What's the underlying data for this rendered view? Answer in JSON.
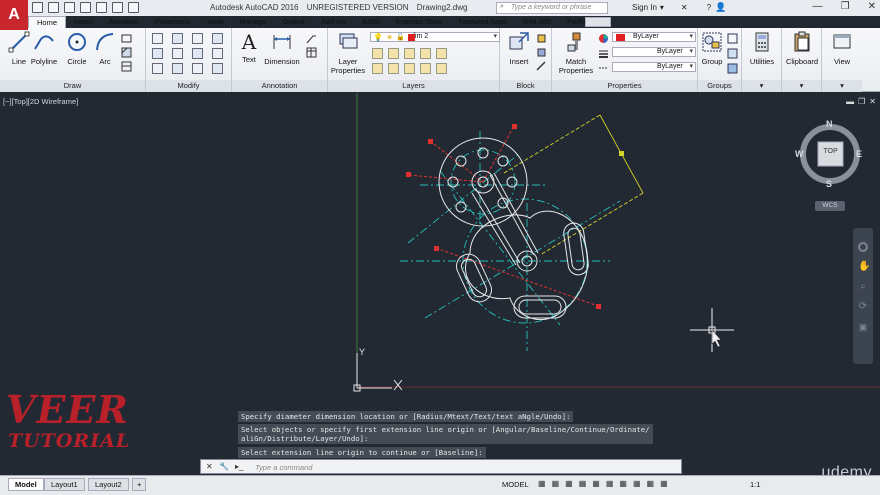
{
  "app": {
    "title": "Autodesk AutoCAD 2016",
    "version_note": "UNREGISTERED VERSION",
    "file": "Drawing2.dwg",
    "search_placeholder": "Type a keyword or phrase",
    "signin": "Sign In"
  },
  "tabs": [
    "Home",
    "Insert",
    "Annotate",
    "Parametric",
    "View",
    "Manage",
    "Output",
    "Add-ins",
    "A360",
    "Express Tools",
    "Featured Apps",
    "BIM 360",
    "Performance"
  ],
  "ribbon": {
    "draw": {
      "title": "Draw",
      "line": "Line",
      "polyline": "Polyline",
      "circle": "Circle",
      "arc": "Arc"
    },
    "modify": {
      "title": "Modify"
    },
    "annotation": {
      "title": "Annotation",
      "text": "Text",
      "dimension": "Dimension"
    },
    "layers": {
      "title": "Layers",
      "layer_props": "Layer",
      "layer_props2": "Properties",
      "current_layer": "dim 2"
    },
    "block": {
      "title": "Block",
      "insert": "Insert"
    },
    "properties": {
      "title": "Properties",
      "match": "Match",
      "match2": "Properties",
      "color": "ByLayer",
      "linetype": "ByLayer",
      "lineweight": "ByLayer"
    },
    "groups": {
      "title": "Groups",
      "group": "Group"
    },
    "utilities": "Utilities",
    "clipboard": "Clipboard",
    "view": "View"
  },
  "viewport": {
    "label": "[−][Top][2D Wireframe]",
    "viewcube_top": "TOP",
    "compass": {
      "n": "N",
      "s": "S",
      "e": "E",
      "w": "W"
    },
    "ucs_label": "WCS"
  },
  "command": {
    "history": [
      "Specify diameter dimension location or [Radius/Mtext/Text/text aNgle/Undo]:",
      "Select objects or specify first extension line origin or [Angular/Baseline/Continue/Ordinate/\naliGn/Distribute/Layer/Undo]:",
      "Select extension line origin to continue or [Baseline]:"
    ],
    "placeholder": "Type a command"
  },
  "status": {
    "layouts": [
      "Model",
      "Layout1",
      "Layout2"
    ],
    "add_layout": "+",
    "mode": "MODEL",
    "scale": "1:1"
  },
  "watermark": {
    "line1": "VEER",
    "line2": "TUTORIAL"
  },
  "udemy": "udemy",
  "colors": {
    "app_red": "#c8262c",
    "viewport_bg": "#222933",
    "geometry": "#e8e8e8",
    "center_lines": "#2bc6c0",
    "dim_lines": "#d8d830",
    "red_lines": "#e03030",
    "y_axis": "#4a9a3a"
  }
}
